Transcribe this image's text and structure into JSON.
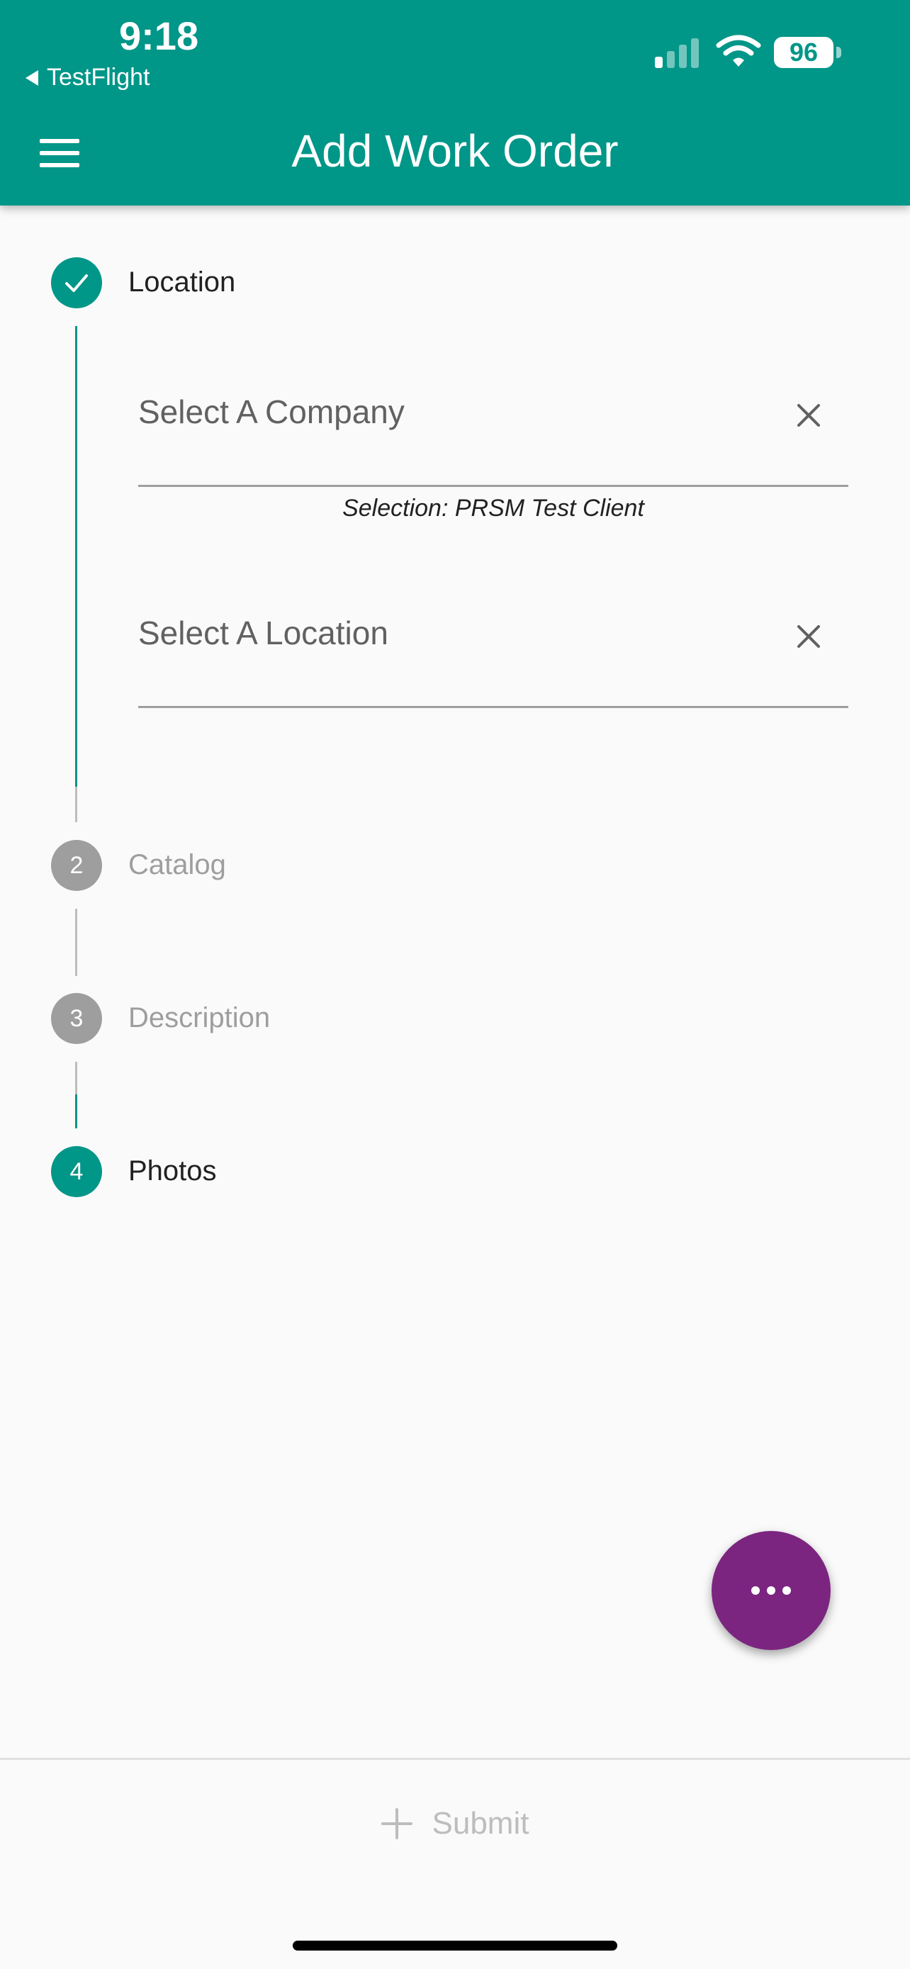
{
  "status_bar": {
    "time": "9:18",
    "back_app": "TestFlight",
    "battery": "96"
  },
  "appbar": {
    "title": "Add Work Order",
    "menu_icon": "hamburger-menu-icon"
  },
  "steps": [
    {
      "marker": "check-icon",
      "label": "Location",
      "state": "completed"
    },
    {
      "marker": "2",
      "label": "Catalog",
      "state": "inactive"
    },
    {
      "marker": "3",
      "label": "Description",
      "state": "inactive"
    },
    {
      "marker": "4",
      "label": "Photos",
      "state": "active"
    }
  ],
  "location_step": {
    "company_field": {
      "label": "Select A Company",
      "clear_icon": "close-icon"
    },
    "selection_text": "Selection: PRSM Test Client",
    "location_field": {
      "label": "Select A Location",
      "clear_icon": "close-icon"
    }
  },
  "fab": {
    "icon": "more-horizontal-icon"
  },
  "footer": {
    "submit_label": "Submit",
    "submit_icon": "plus-icon"
  },
  "colors": {
    "primary": "#009688",
    "fab": "#7b2580",
    "inactive": "#9e9e9e"
  }
}
